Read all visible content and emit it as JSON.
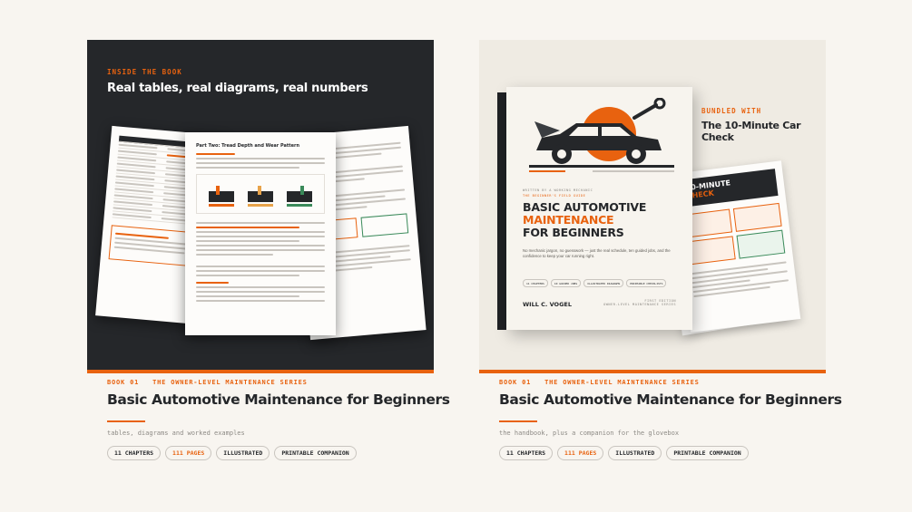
{
  "left": {
    "kicker": "INSIDE THE BOOK",
    "headline": "Real tables, real diagrams, real numbers",
    "page_heading": "Part Two: Tread Depth and Wear Pattern",
    "series": "BOOK 01   THE OWNER-LEVEL MAINTENANCE SERIES",
    "title": "Basic Automotive Maintenance for Beginners",
    "subtitle": "tables, diagrams and worked examples",
    "chips": [
      "11 CHAPTERS",
      "111 PAGES",
      "ILLUSTRATED",
      "PRINTABLE COMPANION"
    ]
  },
  "right": {
    "book": {
      "kicker": "WRITTEN BY A WORKING MECHANIC",
      "kicker2": "THE BEGINNER'S FIELD GUIDE",
      "title_1": "BASIC AUTOMOTIVE",
      "title_2": "MAINTENANCE",
      "title_3": "FOR BEGINNERS",
      "desc": "No mechanic jargon, no guesswork — just the real schedule, ten guided jobs, and the confidence to keep your car running right.",
      "chips": [
        "11 CHAPTERS",
        "10 GUIDED JOBS",
        "ILLUSTRATED DIAGRAMS",
        "PRINTABLE CHECKLISTS"
      ],
      "author": "WILL C. VOGEL",
      "edition": "FIRST EDITION",
      "edition2": "OWNER-LEVEL MAINTENANCE SERIES"
    },
    "bundled_kicker": "BUNDLED WITH",
    "bundled_title": "The 10-Minute Car Check",
    "companion_title_1": "10-MINUTE",
    "companion_title_2": "CHECK",
    "series": "BOOK 01   THE OWNER-LEVEL MAINTENANCE SERIES",
    "title": "Basic Automotive Maintenance for Beginners",
    "subtitle": "the handbook, plus a companion for the glovebox",
    "chips": [
      "11 CHAPTERS",
      "111 PAGES",
      "ILLUSTRATED",
      "PRINTABLE COMPANION"
    ]
  },
  "colors": {
    "accent": "#e8620f",
    "dark": "#25272a",
    "cream": "#f8f5f0"
  }
}
